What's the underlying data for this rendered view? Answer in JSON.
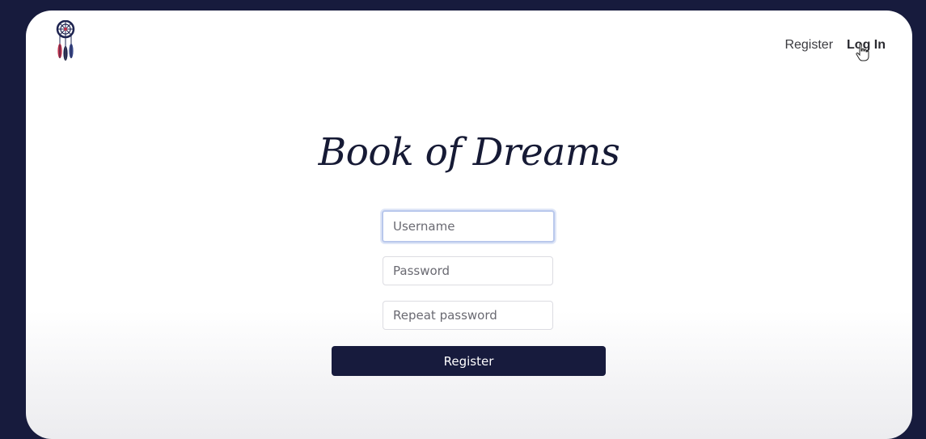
{
  "nav": {
    "register_label": "Register",
    "login_label": "Log In"
  },
  "header": {
    "title": "Book of Dreams"
  },
  "form": {
    "username_placeholder": "Username",
    "username_value": "",
    "password_placeholder": "Password",
    "password_value": "",
    "repeat_password_placeholder": "Repeat password",
    "repeat_password_value": "",
    "submit_label": "Register"
  },
  "icons": {
    "logo": "dreamcatcher-icon",
    "cursor": "hand-pointer-icon"
  },
  "colors": {
    "background": "#171b3d",
    "button": "#171b3d",
    "surface": "#ffffff",
    "focus_ring": "#b9c8ec"
  }
}
